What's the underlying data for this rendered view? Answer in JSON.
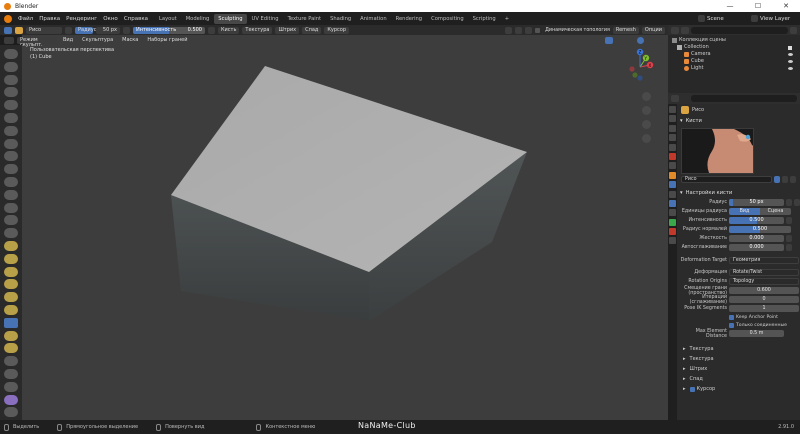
{
  "window": {
    "title": "Blender",
    "controls": [
      "—",
      "☐",
      "✕"
    ]
  },
  "menubar": {
    "menus": [
      "Файл",
      "Правка",
      "Рендеринг",
      "Окно",
      "Справка"
    ],
    "workspaces": [
      "Layout",
      "Modeling",
      "Sculpting",
      "UV Editing",
      "Texture Paint",
      "Shading",
      "Animation",
      "Rendering",
      "Compositing",
      "Scripting"
    ],
    "active_workspace": "Sculpting",
    "add_tab": "+",
    "scene_label": "Scene",
    "view_layer_label": "View Layer"
  },
  "toolheader": {
    "brush_name": "Рисо",
    "radius_label": "Радиус",
    "radius_value": "50 px",
    "strength_label": "Интенсивность",
    "strength_value": "0.500",
    "strength_fraction": 0.5,
    "menus": [
      "Кисть",
      "Текстура",
      "Штрих",
      "Спад",
      "Курсор"
    ],
    "symmetry_label": "Динамическая топология",
    "extra_menus": [
      "Remesh",
      "Опции"
    ]
  },
  "viewheader": {
    "mode": "Режим скульпт.",
    "menus": [
      "Вид",
      "Скульптура",
      "Маска",
      "Наборы граней"
    ]
  },
  "viewport": {
    "overlay_line1": "Пользовательская перспектива",
    "overlay_line2": "(1) Cube",
    "bg_color": "#3d3d3d"
  },
  "gizmo": {
    "x": "X",
    "y": "Y",
    "z": "Z"
  },
  "outliner": {
    "search_placeholder": "",
    "root": "Коллекция сцены",
    "collection": "Collection",
    "items": [
      {
        "name": "Camera",
        "icon": "camera-icon",
        "color": "#e88a3a"
      },
      {
        "name": "Cube",
        "icon": "mesh-icon",
        "color": "#e88a3a"
      },
      {
        "name": "Light",
        "icon": "light-icon",
        "color": "#e88a3a"
      }
    ]
  },
  "properties": {
    "header_name": "Рисо",
    "brushes_section": "Кисти",
    "brush_field": "Рисо",
    "settings_section": "Настройки кисти",
    "fields": [
      {
        "label": "Радиус",
        "value": "50 px",
        "fill": 0.08
      },
      {
        "label": "Единицы радиуса",
        "opt1": "Вид",
        "opt2": "Сцена"
      },
      {
        "label": "Интенсивность",
        "value": "0.500",
        "fill": 0.5
      },
      {
        "label": "Радиус нормалей",
        "value": "0.500",
        "fill": 0.5
      },
      {
        "label": "Жесткость",
        "value": "0.000",
        "fill": 0.0
      },
      {
        "label": "Автосглаживание",
        "value": "0.000",
        "fill": 0.0
      }
    ],
    "deformation_target_label": "Deformation Target",
    "deformation_target_value": "Геометрия",
    "deformation_label": "Деформация",
    "deformation_value": "Rotate/Twist",
    "rotation_origins_label": "Rotation Origins",
    "rotation_origins_value": "Topology",
    "slide_label": "Смещение грани (пространство)",
    "slide_value": "0.600",
    "iterations_label": "Итерации (сглаживание)",
    "iterations_value": "0",
    "fk_segments_label": "Pose IK Segments",
    "fk_segments_value": "1",
    "keep_anchor_label": "Keep Anchor Point",
    "connected_only_label": "Только соединенные",
    "max_elem_label": "Max Element Distance",
    "max_elem_value": "0.5 m",
    "subsections": [
      "Текстура",
      "Текстура",
      "Штрих",
      "Спад"
    ],
    "cursor_label": "Курсор"
  },
  "statusbar": {
    "select": "Выделить",
    "box_select": "Прямоугольное выделение",
    "rotate_view": "Повернуть вид",
    "context_menu": "Контекстное меню",
    "version": "2.91.0"
  },
  "watermark": "NaNaMe-Club"
}
